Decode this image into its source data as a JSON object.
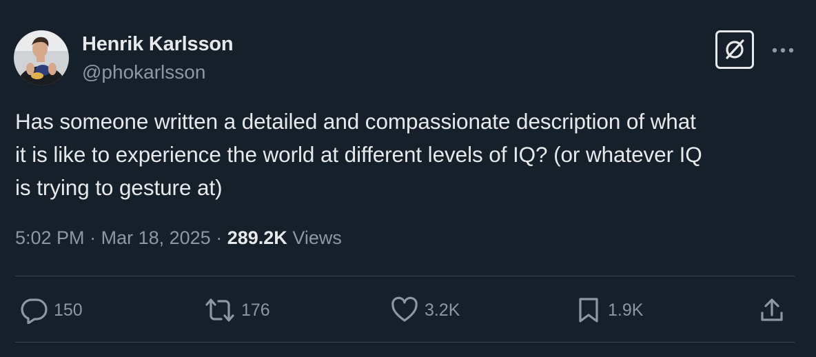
{
  "author": {
    "name": "Henrik Karlsson",
    "handle": "@phokarlsson"
  },
  "tweet": {
    "lines": [
      "Has someone written a detailed and compassionate description of what",
      "it is like to experience the world at different levels of IQ? (or whatever IQ",
      "is trying to gesture at)"
    ]
  },
  "meta": {
    "time": "5:02 PM",
    "separator": "·",
    "date": "Mar 18, 2025",
    "views_count": "289.2K",
    "views_label": "Views"
  },
  "actions": {
    "replies": "150",
    "reposts": "176",
    "likes": "3.2K",
    "bookmarks": "1.9K"
  },
  "icons": {
    "grok": "grok-icon",
    "more": "more-icon",
    "reply": "reply-icon",
    "repost": "repost-icon",
    "like": "heart-icon",
    "bookmark": "bookmark-icon",
    "share": "share-icon"
  },
  "colors": {
    "background": "#15202b",
    "text": "#e7e9ea",
    "secondary": "#8b98a5",
    "divider": "#38444d"
  }
}
